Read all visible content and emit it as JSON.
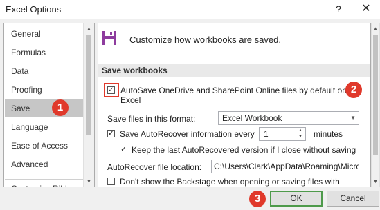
{
  "window": {
    "title": "Excel Options",
    "help_label": "?",
    "close_label": "✕"
  },
  "nav": {
    "items": [
      {
        "label": "General"
      },
      {
        "label": "Formulas"
      },
      {
        "label": "Data"
      },
      {
        "label": "Proofing"
      },
      {
        "label": "Save"
      },
      {
        "label": "Language"
      },
      {
        "label": "Ease of Access"
      },
      {
        "label": "Advanced"
      },
      {
        "label": "Customize Ribbon"
      }
    ],
    "selected": "Save"
  },
  "main": {
    "header": "Customize how workbooks are saved.",
    "section_title": "Save workbooks",
    "autosave_label_line1": "AutoSave OneDrive and SharePoint Online files by default on",
    "autosave_label_line2": "Excel",
    "autosave_checked": "✓",
    "format_label": "Save files in this format:",
    "format_value": "Excel Workbook",
    "autorecover_label": "Save AutoRecover information every",
    "autorecover_checked": "✓",
    "autorecover_minutes": "1",
    "minutes_label": "minutes",
    "keep_label": "Keep the last AutoRecovered version if I close without saving",
    "keep_checked": "✓",
    "file_location_label": "AutoRecover file location:",
    "file_location_value": "C:\\Users\\Clark\\AppData\\Roaming\\Micro",
    "backstage_label": "Don't show the Backstage when opening or saving files with"
  },
  "footer": {
    "ok_label": "OK",
    "cancel_label": "Cancel"
  },
  "badges": {
    "one": "1",
    "two": "2",
    "three": "3"
  },
  "colors": {
    "accent_red": "#e0392b",
    "ok_green": "#4e9a4b",
    "save_icon": "#8e3c9e",
    "selected_nav": "#c6c6c6"
  },
  "icons": {
    "save": "save-icon",
    "checkbox": "checkmark-icon",
    "dropdown": "chevron-down-icon"
  }
}
